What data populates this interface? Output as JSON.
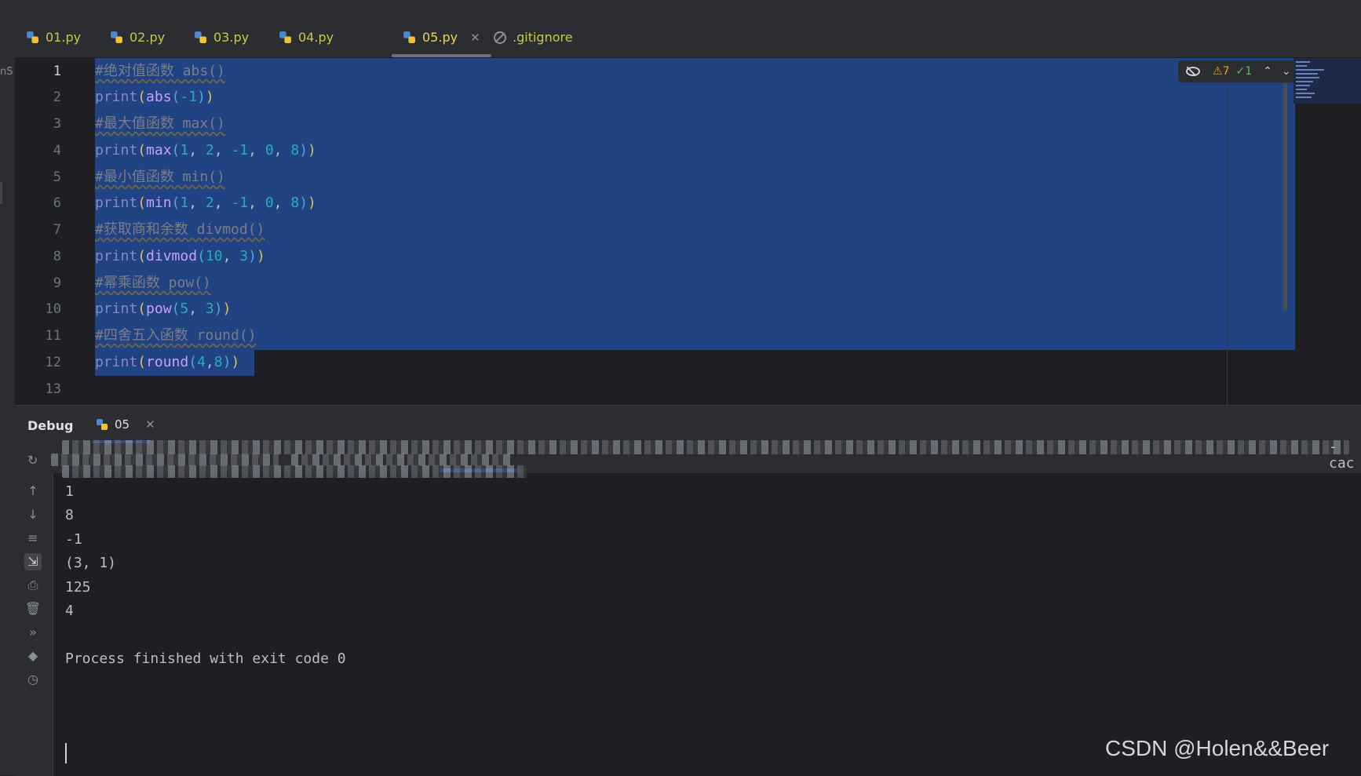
{
  "sidebar_fragment": "nS",
  "tabs": [
    {
      "label": "01.py",
      "active": false
    },
    {
      "label": "02.py",
      "active": false
    },
    {
      "label": "03.py",
      "active": false
    },
    {
      "label": "04.py",
      "active": false
    },
    {
      "label": "05.py",
      "active": true
    },
    {
      "label": ".gitignore",
      "active": false
    }
  ],
  "editor": {
    "line_numbers": [
      "1",
      "2",
      "3",
      "4",
      "5",
      "6",
      "7",
      "8",
      "9",
      "10",
      "11",
      "12",
      "13"
    ],
    "inspection": {
      "warnings": "7",
      "weak_warnings": "1"
    },
    "lines": [
      "#绝对值函数 abs()",
      "print(abs(-1))",
      "#最大值函数 max()",
      "print(max(1, 2, -1, 0, 8))",
      "#最小值函数 min()",
      "print(min(1, 2, -1, 0, 8))",
      "#获取商和余数 divmod()",
      "print(divmod(10, 3))",
      "#幂乘函数 pow()",
      "print(pow(5, 3))",
      "#四舍五入函数 round()",
      "print(round(4,8))",
      ""
    ]
  },
  "debug": {
    "title": "Debug",
    "session_tab": "05",
    "command_tail": "-cac",
    "output": [
      "1",
      "8",
      "-1",
      "(3, 1)",
      "125",
      "4",
      "",
      "Process finished with exit code 0"
    ]
  },
  "watermark": "CSDN @Holen&&Beer",
  "colors": {
    "selection": "#214283",
    "background": "#1e1f22",
    "panel": "#2b2d30"
  }
}
